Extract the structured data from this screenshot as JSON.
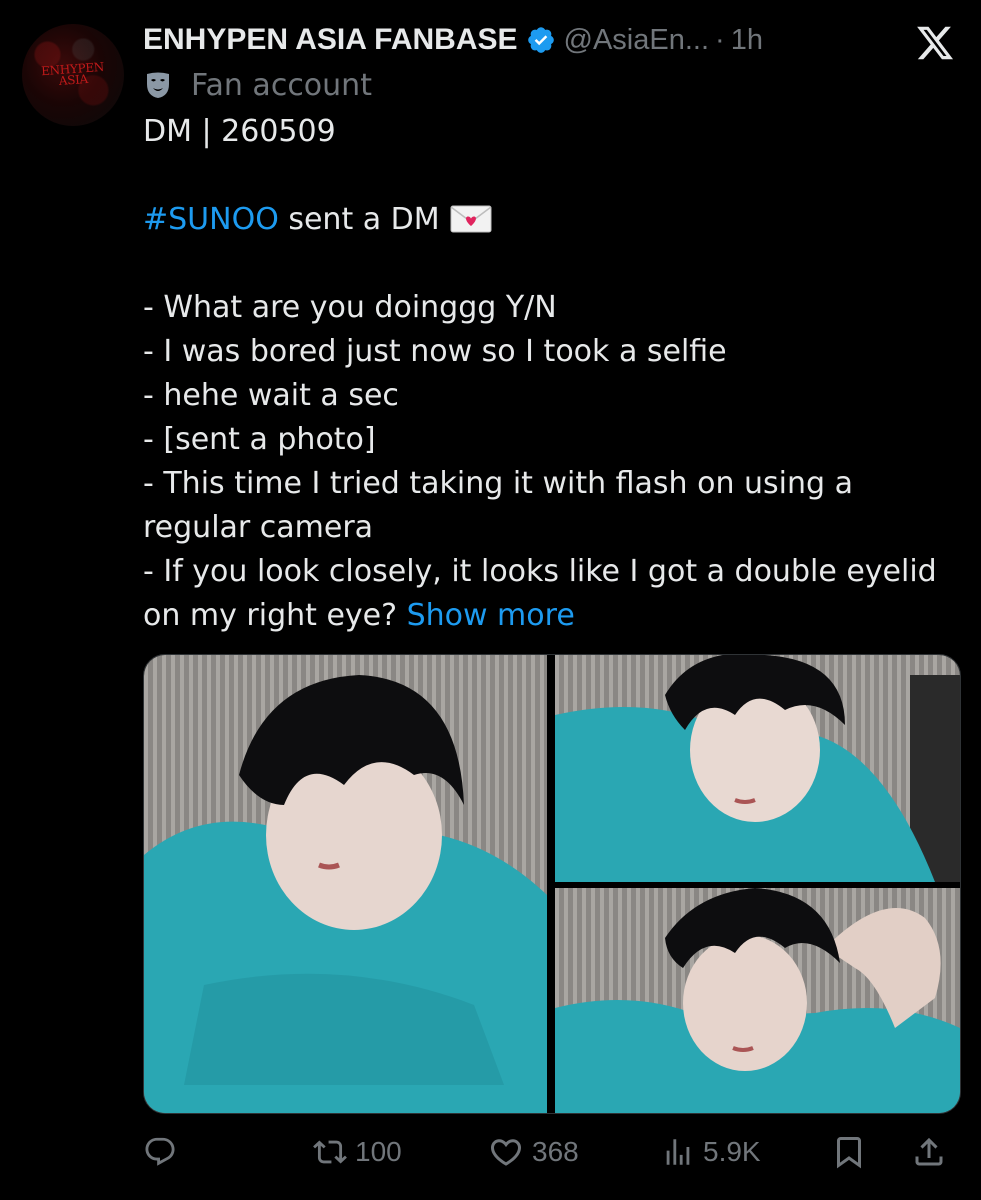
{
  "header": {
    "display_name": "ENHYPEN ASIA FANBASE",
    "handle": "@AsiaEn...",
    "separator": "·",
    "time": "1h"
  },
  "avatar": {
    "logo_text": "ENHYPEN ASIA"
  },
  "label": {
    "icon": "theater-mask-icon",
    "text": "Fan account"
  },
  "body": {
    "line1": "DM | 260509",
    "hashtag": "#SUNOO",
    "line3_rest": " sent a DM",
    "line3_emoji": "envelope-with-heart-icon",
    "lines": [
      "- What are you doinggg Y/N",
      "- I was bored just now so I took a selfie",
      "- hehe wait a sec",
      "- [sent a photo]",
      "- This time I tried taking it with flash on using a",
      "regular camera",
      "- If you look closely, it looks like I got a double eyelid"
    ],
    "last_line": "on my right eye? ",
    "show_more": "Show more"
  },
  "media": {
    "count": 3
  },
  "actions": {
    "reply": {
      "icon": "reply-icon",
      "count": ""
    },
    "repost": {
      "icon": "repost-icon",
      "count": "100"
    },
    "like": {
      "icon": "heart-icon",
      "count": "368"
    },
    "views": {
      "icon": "views-icon",
      "count": "5.9K"
    },
    "bookmark": {
      "icon": "bookmark-icon"
    },
    "share": {
      "icon": "share-icon"
    }
  },
  "colors": {
    "background": "#000000",
    "text": "#e7e9ea",
    "muted": "#71767b",
    "link": "#1d9bf0",
    "verified": "#1d9bf0",
    "shirt": "#2aa7b3"
  }
}
